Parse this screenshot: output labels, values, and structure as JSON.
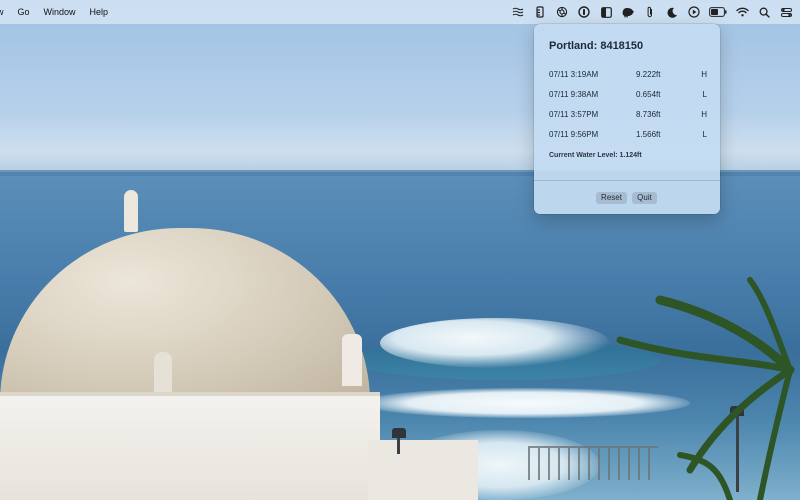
{
  "menubar": {
    "items": [
      {
        "label": "w"
      },
      {
        "label": "Go"
      },
      {
        "label": "Window"
      },
      {
        "label": "Help"
      }
    ],
    "status_icons": [
      "tide-waves-icon",
      "ruler-icon",
      "openai-icon",
      "onepassword-icon",
      "sidebar-icon",
      "mastodon-icon",
      "paperclip-icon",
      "moon-icon",
      "play-circle-icon",
      "battery-icon",
      "wifi-icon",
      "search-icon",
      "control-center-icon"
    ]
  },
  "panel": {
    "title": "Portland: 8418150",
    "tides": [
      {
        "time": "07/11 3:19AM",
        "height": "9.222ft",
        "type": "H"
      },
      {
        "time": "07/11 9:38AM",
        "height": "0.654ft",
        "type": "L"
      },
      {
        "time": "07/11 3:57PM",
        "height": "8.736ft",
        "type": "H"
      },
      {
        "time": "07/11 9:56PM",
        "height": "1.566ft",
        "type": "L"
      }
    ],
    "water_level": "Current Water Level: 1.124ft",
    "reset_label": "Reset",
    "quit_label": "Quit"
  }
}
